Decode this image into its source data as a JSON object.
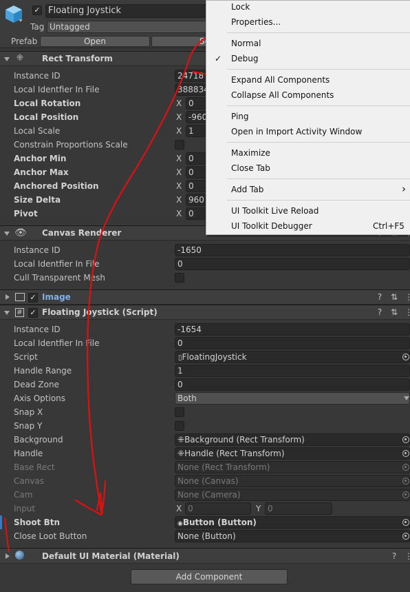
{
  "header": {
    "name": "Floating Joystick",
    "tag_label": "Tag",
    "tag_value": "Untagged",
    "prefab_label": "Prefab",
    "open_label": "Open",
    "select_label": "Se"
  },
  "rect_transform": {
    "title": "Rect Transform",
    "rows": [
      {
        "label": "Instance ID",
        "value": "24718"
      },
      {
        "label": "Local Identfier In File",
        "value": "388834"
      },
      {
        "label": "Local Rotation",
        "x": "0"
      },
      {
        "label": "Local Position",
        "x": "-960"
      },
      {
        "label": "Local Scale",
        "x": "1"
      },
      {
        "label": "Constrain Proportions Scale"
      },
      {
        "label": "Anchor Min",
        "x": "0"
      },
      {
        "label": "Anchor Max",
        "x": "0"
      },
      {
        "label": "Anchored Position",
        "x": "0"
      },
      {
        "label": "Size Delta",
        "x": "960"
      },
      {
        "label": "Pivot",
        "x": "0"
      }
    ]
  },
  "axis_x": "X",
  "axis_y": "Y",
  "canvas_renderer": {
    "title": "Canvas Renderer",
    "rows": [
      {
        "label": "Instance ID",
        "value": "-1650"
      },
      {
        "label": "Local Identfier In File",
        "value": "0"
      },
      {
        "label": "Cull Transparent Mesh"
      }
    ]
  },
  "image": {
    "title": "Image"
  },
  "script_comp": {
    "title": "Floating Joystick (Script)",
    "rows": [
      {
        "label": "Instance ID",
        "value": "-1654"
      },
      {
        "label": "Local Identfier In File",
        "value": "0"
      },
      {
        "label": "Script",
        "value": "FloatingJoystick"
      },
      {
        "label": "Handle Range",
        "value": "1"
      },
      {
        "label": "Dead Zone",
        "value": "0"
      },
      {
        "label": "Axis Options",
        "value": "Both"
      },
      {
        "label": "Snap X"
      },
      {
        "label": "Snap Y"
      },
      {
        "label": "Background",
        "value": "Background (Rect Transform)"
      },
      {
        "label": "Handle",
        "value": "Handle (Rect Transform)"
      },
      {
        "label": "Base Rect",
        "value": "None (Rect Transform)"
      },
      {
        "label": "Canvas",
        "value": "None (Canvas)"
      },
      {
        "label": "Cam",
        "value": "None (Camera)"
      },
      {
        "label": "Input",
        "x": "0",
        "y": "0"
      },
      {
        "label": "Shoot Btn",
        "value": "Button (Button)"
      },
      {
        "label": "Close Loot Button",
        "value": "None (Button)"
      }
    ]
  },
  "material": {
    "title": "Default UI Material (Material)"
  },
  "add_component": "Add Component",
  "context_menu": {
    "items": [
      {
        "label": "Lock"
      },
      {
        "label": "Properties..."
      },
      {
        "label": "Normal"
      },
      {
        "label": "Debug",
        "checked": "✓"
      },
      {
        "label": "Expand All Components"
      },
      {
        "label": "Collapse All Components"
      },
      {
        "label": "Ping"
      },
      {
        "label": "Open in Import Activity Window"
      },
      {
        "label": "Maximize"
      },
      {
        "label": "Close Tab"
      },
      {
        "label": "Add Tab",
        "arrow": "›"
      },
      {
        "label": "UI Toolkit Live Reload"
      },
      {
        "label": "UI Toolkit Debugger",
        "shortcut": "Ctrl+F5"
      }
    ]
  },
  "colors": {
    "annotation": "#e01010",
    "selected_bar": "#3a79bb",
    "link_blue": "#7fb0ea"
  }
}
